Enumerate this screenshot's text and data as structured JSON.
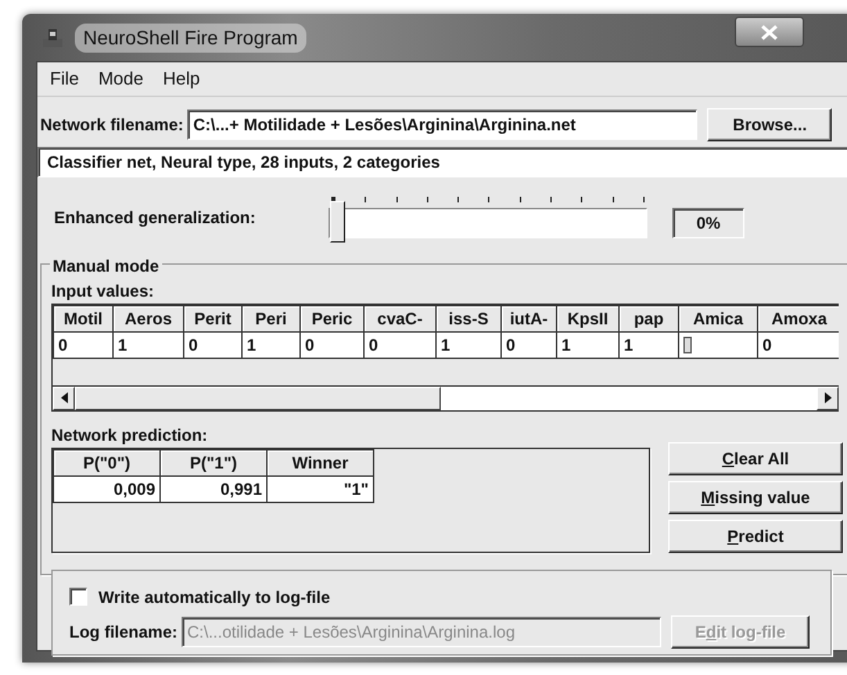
{
  "window": {
    "title": "NeuroShell Fire Program"
  },
  "menu": [
    {
      "label": "File"
    },
    {
      "label": "Mode"
    },
    {
      "label": "Help"
    }
  ],
  "network_file": {
    "label": "Network filename:",
    "value": "C:\\...+ Motilidade + Lesões\\Arginina\\Arginina.net",
    "button": "Browse..."
  },
  "status": "Classifier net, Neural type, 28 inputs, 2 categories",
  "generalization": {
    "label": "Enhanced generalization:",
    "level": 0,
    "reading": "0%"
  },
  "manual_mode": {
    "title": "Manual mode",
    "input_label": "Input values:",
    "columns": [
      "Motil",
      "Aeros",
      "Perit",
      "Peri",
      "Peric",
      "cvaC-",
      "iss-S",
      "iutA-",
      "KpsII",
      "pap",
      "Amica",
      "Amoxa"
    ],
    "values": [
      {
        "value": "0",
        "editing": false
      },
      {
        "value": "1",
        "editing": false
      },
      {
        "value": "0",
        "editing": false
      },
      {
        "value": "1",
        "editing": false
      },
      {
        "value": "0",
        "editing": false
      },
      {
        "value": "0",
        "editing": false
      },
      {
        "value": "1",
        "editing": false
      },
      {
        "value": "0",
        "editing": false
      },
      {
        "value": "1",
        "editing": false
      },
      {
        "value": "1",
        "editing": false
      },
      {
        "editing": true
      },
      {
        "value": "0",
        "editing": false
      }
    ]
  },
  "prediction": {
    "label": "Network prediction:",
    "columns": [
      "P(\"0\")",
      "P(\"1\")",
      "Winner"
    ],
    "row": [
      "0,009",
      "0,991",
      "\"1\""
    ]
  },
  "buttons": [
    {
      "accel": "C",
      "rest": "lear All",
      "disabled": false
    },
    {
      "accel": "M",
      "rest": "issing value",
      "disabled": false
    },
    {
      "accel": "P",
      "rest": "redict",
      "disabled": false
    }
  ],
  "log": {
    "checkbox": {
      "label": "Write automatically to log-file",
      "checked": false
    },
    "label": "Log filename:",
    "value": "C:\\...otilidade + Lesões\\Arginina\\Arginina.log",
    "button": {
      "lead": "E",
      "accel": "d",
      "rest": "it log-file",
      "disabled": true
    }
  }
}
